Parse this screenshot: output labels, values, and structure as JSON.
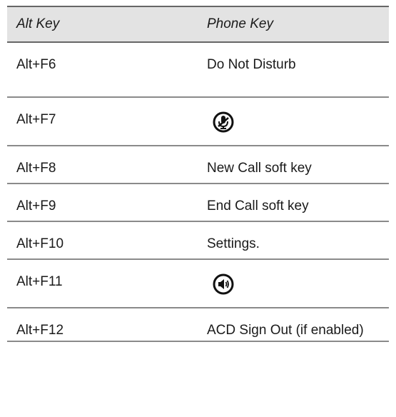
{
  "table": {
    "headers": {
      "alt_key": "Alt Key",
      "phone_key": "Phone Key"
    },
    "rows": [
      {
        "alt_key": "Alt+F6",
        "phone_key": "Do Not Disturb",
        "phone_key_icon": null
      },
      {
        "alt_key": "Alt+F7",
        "phone_key": "",
        "phone_key_icon": "mute-microphone-icon"
      },
      {
        "alt_key": "Alt+F8",
        "phone_key": "New Call soft key",
        "phone_key_icon": null
      },
      {
        "alt_key": "Alt+F9",
        "phone_key": "End Call soft key",
        "phone_key_icon": null
      },
      {
        "alt_key": "Alt+F10",
        "phone_key": "Settings.",
        "phone_key_icon": null
      },
      {
        "alt_key": "Alt+F11",
        "phone_key": "",
        "phone_key_icon": "speakerphone-icon"
      },
      {
        "alt_key": "Alt+F12",
        "phone_key": "ACD Sign Out (if enabled)",
        "phone_key_icon": null
      }
    ]
  },
  "colors": {
    "header_background": "#e3e3e3",
    "rule": "#666666",
    "text": "#1a1a1a"
  }
}
